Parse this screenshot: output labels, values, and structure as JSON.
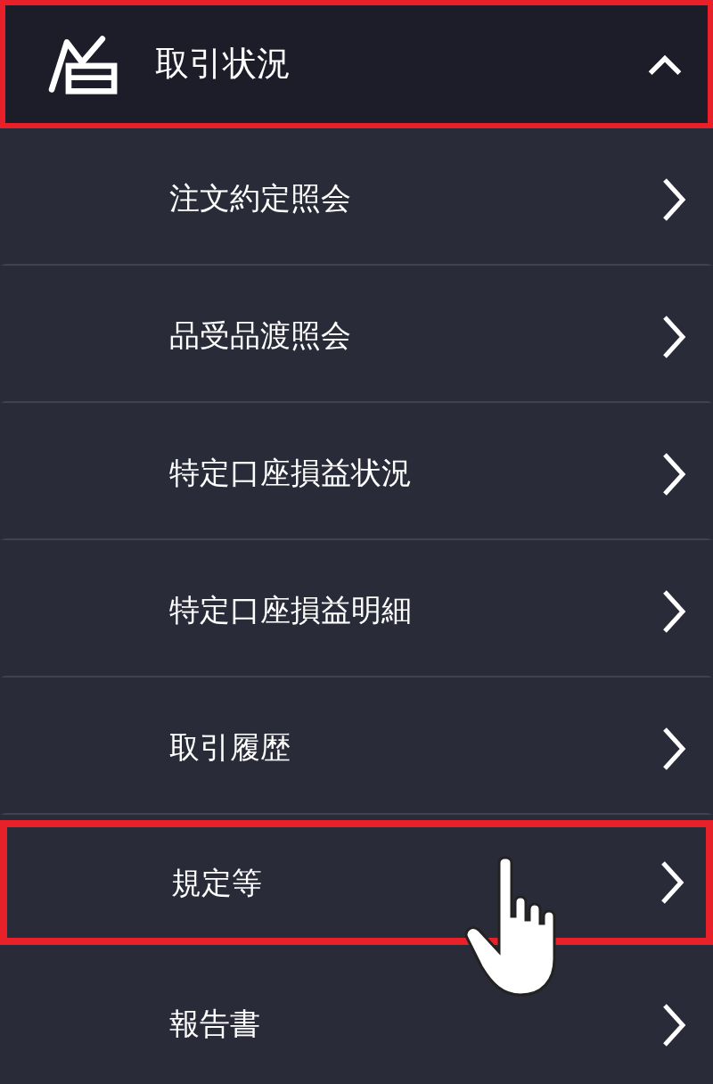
{
  "header": {
    "title": "取引状況",
    "expanded": true,
    "highlighted": true
  },
  "items": [
    {
      "label": "注文約定照会",
      "highlighted": false
    },
    {
      "label": "品受品渡照会",
      "highlighted": false
    },
    {
      "label": "特定口座損益状況",
      "highlighted": false
    },
    {
      "label": "特定口座損益明細",
      "highlighted": false
    },
    {
      "label": "取引履歴",
      "highlighted": false
    },
    {
      "label": "規定等",
      "highlighted": true
    },
    {
      "label": "報告書",
      "highlighted": false
    }
  ]
}
